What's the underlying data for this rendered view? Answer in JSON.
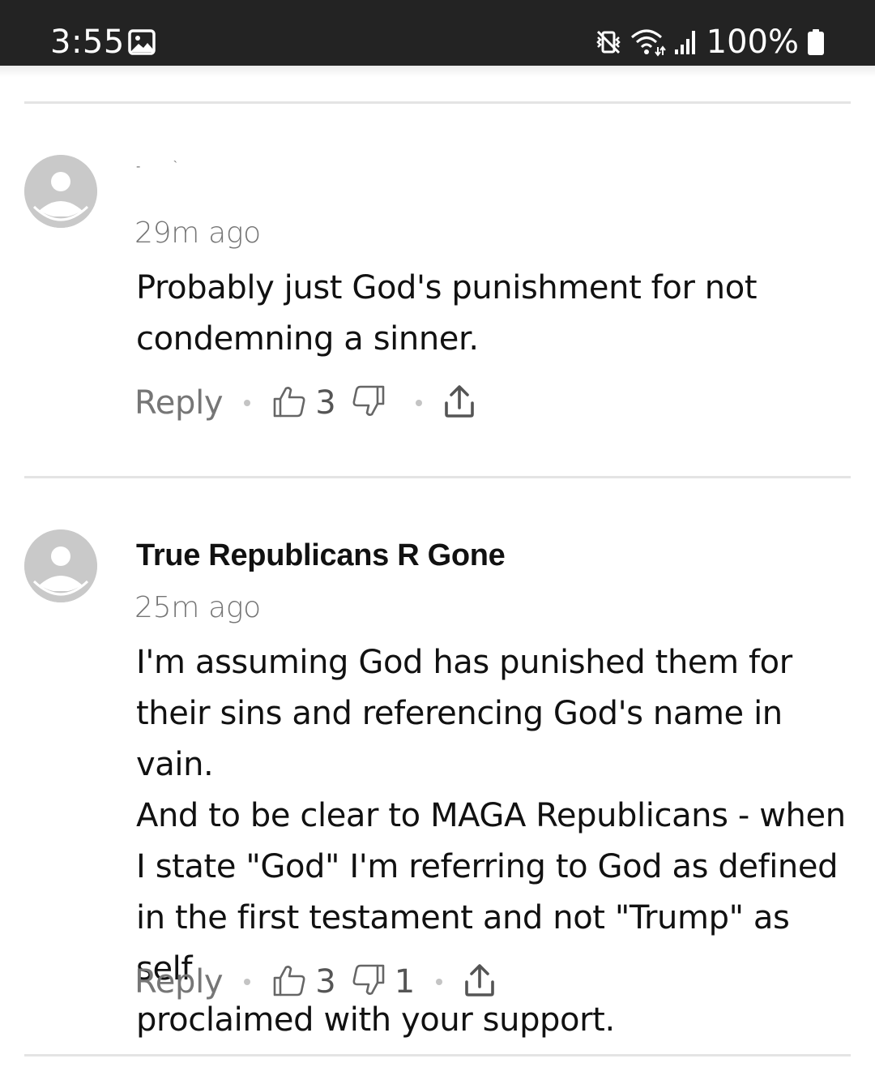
{
  "status_bar": {
    "time": "3:55",
    "battery": "100%",
    "icons": [
      "gallery-icon",
      "vibrate-mute-icon",
      "wifi-icon",
      "signal-icon",
      "battery-icon"
    ]
  },
  "comments": [
    {
      "author": "- `",
      "timestamp": "29m ago",
      "text_lines": [
        "Probably just God's punishment for not",
        "condemning a sinner."
      ],
      "reply_label": "Reply",
      "likes": "3",
      "dislikes": ""
    },
    {
      "author": "True Republicans R Gone",
      "timestamp": "25m ago",
      "text_lines": [
        "I'm assuming God has punished them for",
        "their sins and referencing God's name in vain.",
        "And to be clear to MAGA Republicans - when",
        "I state \"God\" I'm referring to God as defined",
        "in the first testament and not \"Trump\" as self",
        "proclaimed with your support."
      ],
      "reply_label": "Reply",
      "likes": "3",
      "dislikes": "1"
    }
  ],
  "colors": {
    "status_bar": "#232323",
    "muted_text": "#767676",
    "divider": "#e4e4e4",
    "avatar": "#c9c9c9"
  }
}
